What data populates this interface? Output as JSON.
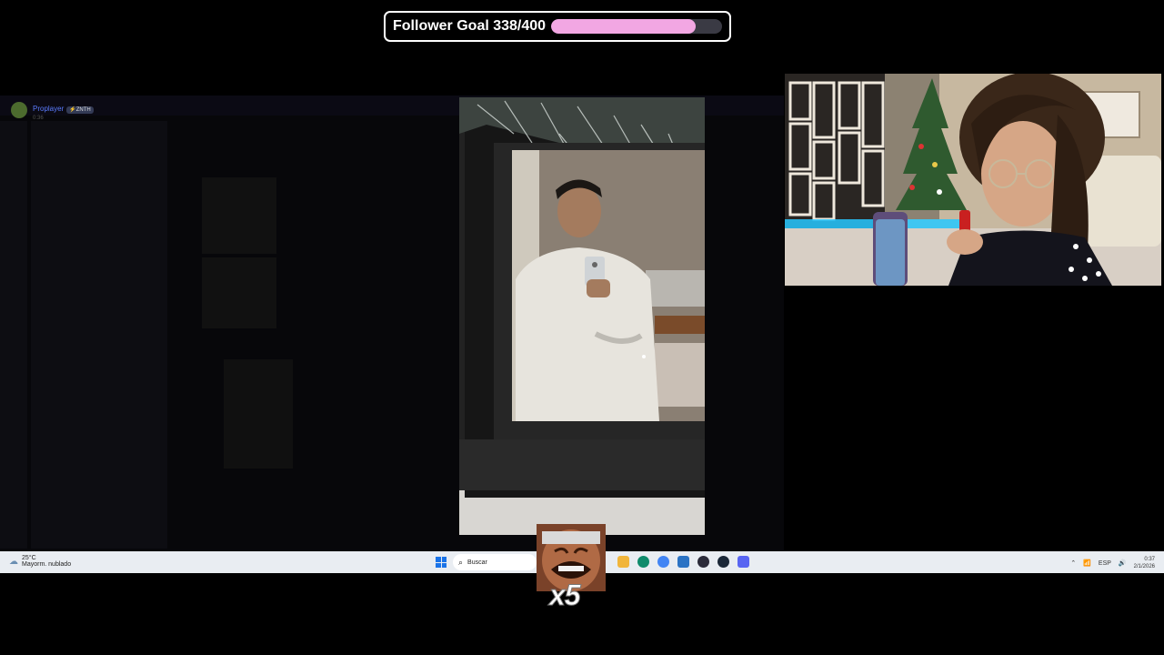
{
  "follower_goal": {
    "label": "Follower Goal 338/400",
    "current": 338,
    "target": 400,
    "progress": 0.845,
    "fill_color": "#f2a7e3"
  },
  "discord": {
    "username": "Proplayer",
    "badge": "⚡ZNTH",
    "time": "0:36"
  },
  "taskbar": {
    "weather_temp": "25°C",
    "weather_desc": "Mayorm. nublado",
    "weather_icon": "cloud-sun-icon",
    "search_placeholder": "Buscar",
    "lang": "ESP",
    "time": "0:37",
    "date": "2/1/2026",
    "apps": [
      "start-icon",
      "edge-icon",
      "chrome-icon",
      "notepad-icon",
      "obs-icon",
      "steam-icon",
      "discord-icon"
    ]
  },
  "emote": {
    "count_label": "x5"
  },
  "colors": {
    "accent_pink": "#f2a7e3",
    "discord_blue": "#5b7cff",
    "led_cyan": "#27c8ff"
  }
}
